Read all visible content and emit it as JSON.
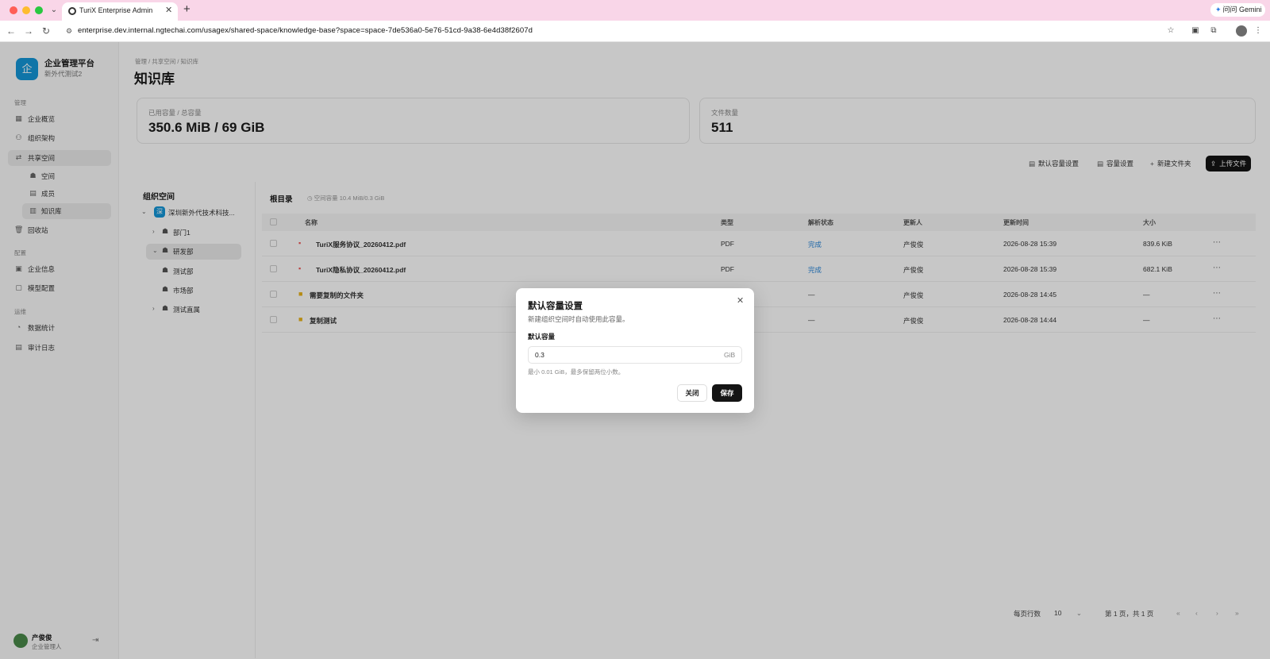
{
  "browser": {
    "tab_title": "TuriX Enterprise Admin",
    "url": "enterprise.dev.internal.ngtechai.com/usagex/shared-space/knowledge-base?space=space-7de536a0-5e76-51cd-9a38-6e4d38f2607d",
    "gemini_label": "问问 Gemini"
  },
  "sidebar": {
    "brand_name": "企业管理平台",
    "brand_sub": "新外代测试2",
    "brand_logo_char": "企",
    "sections": {
      "manage": "管理",
      "settings": "配置",
      "ops": "运维"
    },
    "items": {
      "home": "企业概览",
      "org": "组织架构",
      "shared": "共享空间",
      "space": "空间",
      "members": "成员",
      "kb": "知识库",
      "recycle": "回收站",
      "ent_info": "企业信息",
      "model": "模型配置",
      "stats": "数据统计",
      "audit": "审计日志"
    },
    "user": {
      "name": "产俊俊",
      "role": "企业管理人"
    }
  },
  "header": {
    "breadcrumb": "管理 / 共享空间 / 知识库",
    "title": "知识库"
  },
  "stats": {
    "capacity_label": "已用容量 / 总容量",
    "capacity_value": "350.6 MiB / 69 GiB",
    "files_label": "文件数量",
    "files_value": "511"
  },
  "toolbar": {
    "default_capacity": "默认容量设置",
    "capacity_settings": "容量设置",
    "new_folder": "新建文件夹",
    "upload": "上传文件"
  },
  "tree": {
    "title": "组织空间",
    "org": "深圳新外代技术科技...",
    "org_icon": "深",
    "nodes": [
      "部门1",
      "研发部",
      "测试部",
      "市场部",
      "测试直属"
    ]
  },
  "table": {
    "root_label": "根目录",
    "used_label": "空间容量 10.4 MiB/0.3 GiB",
    "headers": [
      "名称",
      "类型",
      "解析状态",
      "更新人",
      "更新时间",
      "大小"
    ],
    "rows": [
      {
        "name": "TuriX服务协议_20260412.pdf",
        "type": "PDF",
        "status": "完成",
        "updater": "产俊俊",
        "time": "2026-08-28 15:39",
        "size": "839.6 KiB",
        "kind": "pdf"
      },
      {
        "name": "TuriX隐私协议_20260412.pdf",
        "type": "PDF",
        "status": "完成",
        "updater": "产俊俊",
        "time": "2026-08-28 15:39",
        "size": "682.1 KiB",
        "kind": "pdf"
      },
      {
        "name": "需要复制的文件夹",
        "type": "",
        "status": "—",
        "updater": "产俊俊",
        "time": "2026-08-28 14:45",
        "size": "—",
        "kind": "folder"
      },
      {
        "name": "复制测试",
        "type": "",
        "status": "—",
        "updater": "产俊俊",
        "time": "2026-08-28 14:44",
        "size": "—",
        "kind": "folder"
      }
    ]
  },
  "pager": {
    "rows_per_page_label": "每页行数",
    "rows_per_page": "10",
    "page_info": "第 1 页，共 1 页"
  },
  "modal": {
    "title": "默认容量设置",
    "desc": "新建组织空间时自动使用此容量。",
    "field_label": "默认容量",
    "field_value": "0.3",
    "unit": "GiB",
    "hint": "最小 0.01 GiB，最多保留两位小数。",
    "cancel": "关闭",
    "save": "保存"
  }
}
